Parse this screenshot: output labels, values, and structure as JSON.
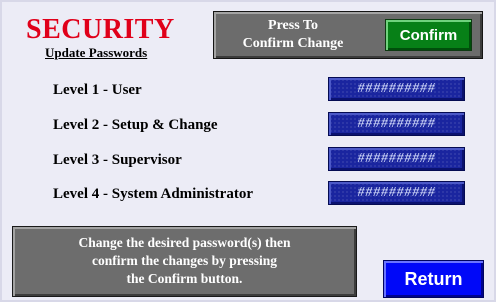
{
  "header": {
    "title": "SECURITY",
    "subtitle": "Update Passwords"
  },
  "confirm_panel": {
    "prompt": "Press To\nConfirm Change",
    "confirm_label": "Confirm"
  },
  "levels": [
    {
      "label": "Level 1 - User",
      "value": "##########"
    },
    {
      "label": "Level 2 - Setup & Change",
      "value": "##########"
    },
    {
      "label": "Level 3 - Supervisor",
      "value": "##########"
    },
    {
      "label": "Level 4 - System Administrator",
      "value": "##########"
    }
  ],
  "instructions": {
    "text": "Change the desired password(s) then\nconfirm the changes by pressing\nthe Confirm button."
  },
  "return_button": {
    "label": "Return"
  },
  "colors": {
    "title_red": "#e0001a",
    "panel_gray": "#6c6c6c",
    "confirm_green": "#078017",
    "password_blue": "#1a259f",
    "return_blue": "#0008f8",
    "background": "#ececf6"
  }
}
